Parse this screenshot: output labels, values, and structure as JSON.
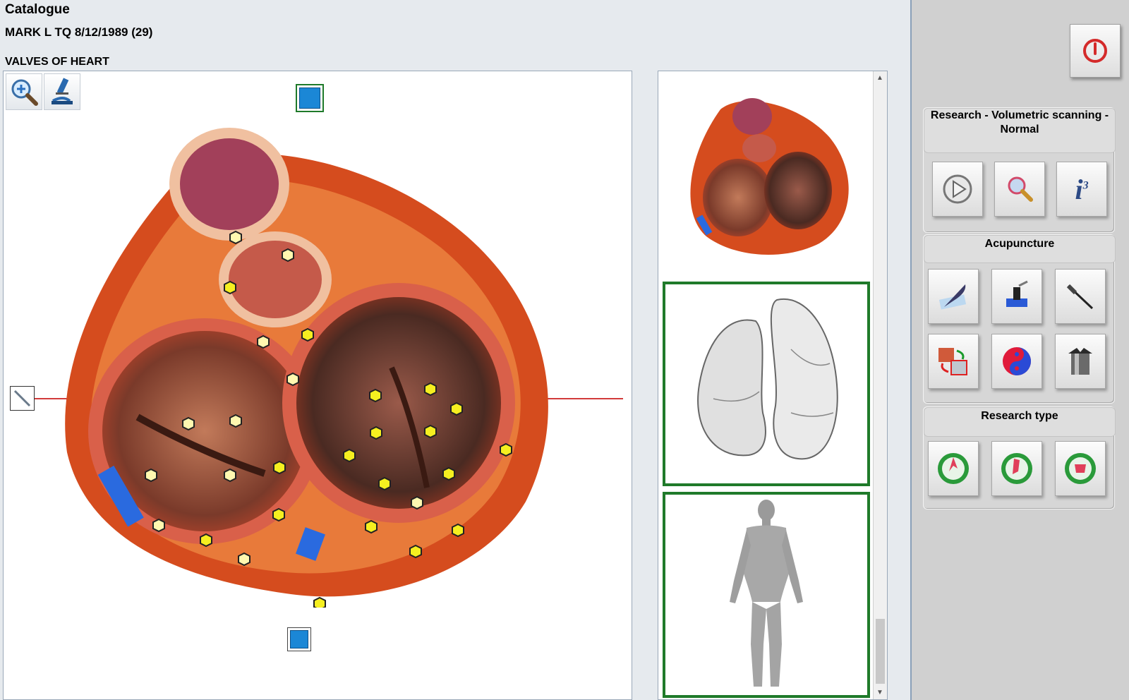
{
  "header": {
    "app_title": "Catalogue",
    "patient": "MARK L TQ  8/12/1989 (29)",
    "section": "VALVES OF HEART"
  },
  "research": {
    "label": "Research - Volumetric scanning - Normal",
    "info_label": "i",
    "info_sup": "3"
  },
  "acupuncture": {
    "label": "Acupuncture"
  },
  "research_type": {
    "label": "Research type"
  },
  "colors": {
    "accent_green": "#1f7a2a",
    "marker_yellow": "#f5ef20",
    "slice_line": "#d23b3b",
    "power_red": "#d42a2a"
  }
}
